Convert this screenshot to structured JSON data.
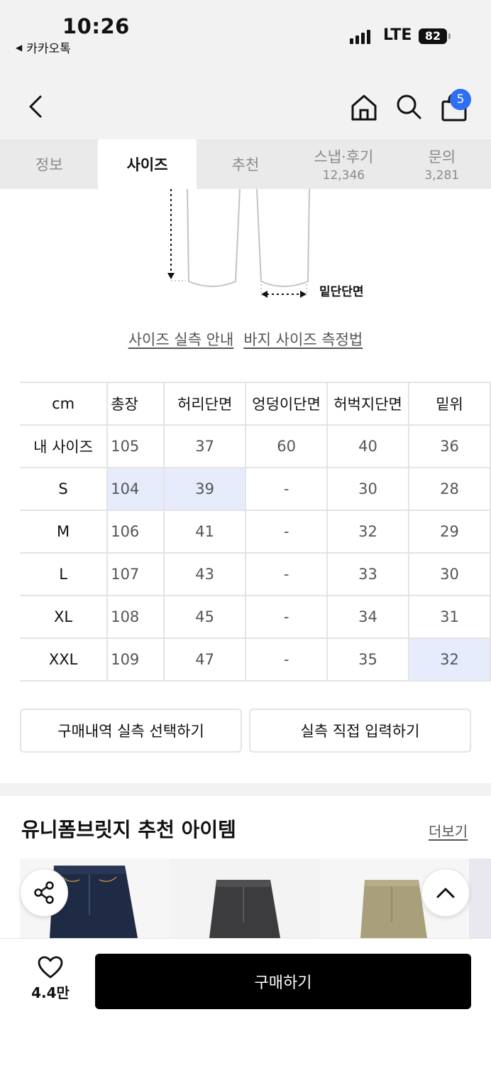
{
  "status_bar": {
    "time": "10:26",
    "back_app": "카카오톡",
    "network": "LTE",
    "battery": "82"
  },
  "header": {
    "cart_count": "5",
    "icons": [
      "back-icon",
      "home-icon",
      "search-icon",
      "cart-icon"
    ]
  },
  "tabs": [
    {
      "label": "정보",
      "count": ""
    },
    {
      "label": "사이즈",
      "count": ""
    },
    {
      "label": "추천",
      "count": ""
    },
    {
      "label": "스냅·후기",
      "count": "12,346"
    },
    {
      "label": "문의",
      "count": "3,281"
    }
  ],
  "active_tab": "사이즈",
  "diagram": {
    "hem_label": "밑단단면"
  },
  "guides": {
    "size_guide": "사이즈 실측 안내",
    "measure_guide": "바지 사이즈 측정법"
  },
  "size_table": {
    "unit": "cm",
    "columns": [
      "총장",
      "허리단면",
      "엉덩이단면",
      "허벅지단면",
      "밑위"
    ],
    "rows": [
      {
        "label": "내 사이즈",
        "values": [
          "105",
          "37",
          "60",
          "40",
          "36"
        ]
      },
      {
        "label": "S",
        "values": [
          "104",
          "39",
          "-",
          "30",
          "28"
        ]
      },
      {
        "label": "M",
        "values": [
          "106",
          "41",
          "-",
          "32",
          "29"
        ]
      },
      {
        "label": "L",
        "values": [
          "107",
          "43",
          "-",
          "33",
          "30"
        ]
      },
      {
        "label": "XL",
        "values": [
          "108",
          "45",
          "-",
          "34",
          "31"
        ]
      },
      {
        "label": "XXL",
        "values": [
          "109",
          "47",
          "-",
          "35",
          "32"
        ]
      }
    ],
    "highlight_color": "#e6ecfc"
  },
  "actions": {
    "purchase_history": "구매내역 실측 선택하기",
    "manual_input": "실측 직접 입력하기"
  },
  "recommend": {
    "title": "유니폼브릿지 추천 아이템",
    "more": "더보기"
  },
  "bottom": {
    "like_count": "4.4만",
    "buy": "구매하기"
  },
  "colors": {
    "accent": "#2f6ef0",
    "highlight": "#e6ecfc",
    "buy_button": "#000000"
  }
}
